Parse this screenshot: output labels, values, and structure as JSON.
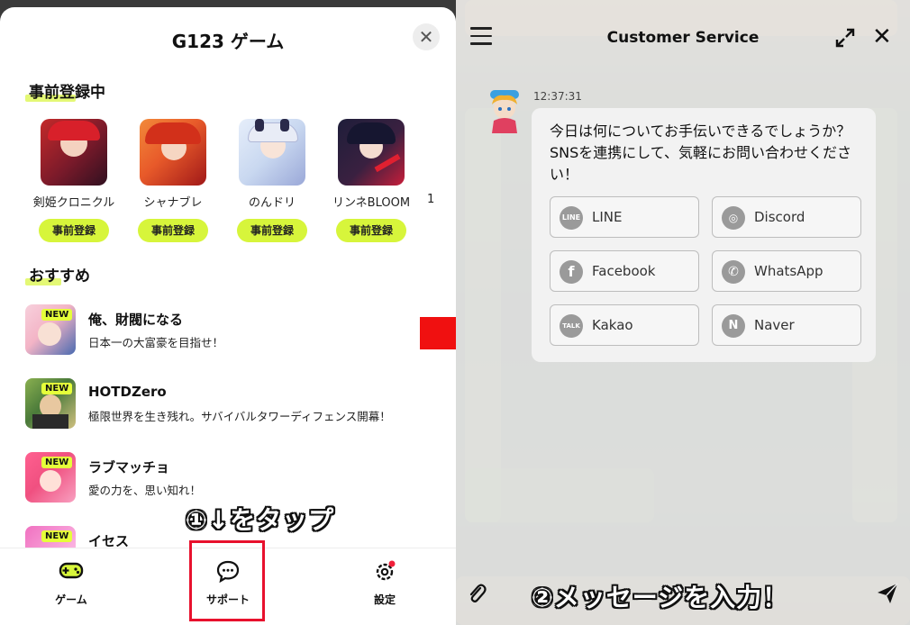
{
  "left": {
    "logo": "G123 ゲーム",
    "close_glyph": "✕",
    "preregister": {
      "title": "事前登録中",
      "items": [
        {
          "name": "剣姫クロニクル",
          "button": "事前登録",
          "color1": "#c42a2a",
          "color2": "#301020"
        },
        {
          "name": "シャナブレ",
          "button": "事前登録",
          "color1": "#e85a2a",
          "color2": "#a01818"
        },
        {
          "name": "のんドリ",
          "button": "事前登録",
          "color1": "#c9d8f0",
          "color2": "#9aa8d8"
        },
        {
          "name": "リンネBLOOM",
          "button": "事前登録",
          "color1": "#1e1e3a",
          "color2": "#c81e3a"
        }
      ],
      "edge_text": "1"
    },
    "recommended": {
      "title": "おすすめ",
      "items": [
        {
          "badge": "NEW",
          "title": "俺、財閥になる",
          "desc": "日本一の大富豪を目指せ！",
          "color1": "#f3b4c6",
          "color2": "#4a6ab0"
        },
        {
          "badge": "NEW",
          "title": "HOTDZero",
          "desc": "極限世界を生き残れ。サバイバルタワーディフェンス開幕！",
          "color1": "#4a7a3a",
          "color2": "#d0c080"
        },
        {
          "badge": "NEW",
          "title": "ラブマッチョ",
          "desc": "愛の力を、思い知れ！",
          "color1": "#f05080",
          "color2": "#f8a0c0"
        },
        {
          "badge": "NEW",
          "title": "イセス",
          "desc": "",
          "color1": "#f070c0",
          "color2": "#ffffff"
        }
      ]
    },
    "instruction": "①↓をタップ",
    "tabs": [
      {
        "label": "ゲーム"
      },
      {
        "label": "サポート"
      },
      {
        "label": "設定"
      }
    ]
  },
  "right": {
    "title": "Customer Service",
    "close_glyph": "✕",
    "timestamp": "12:37:31",
    "message": "今日は何についてお手伝いできるでしょうか？SNSを連携にして、気軽にお問い合わせください！",
    "sns": [
      {
        "label": "LINE",
        "icon": "line-icon",
        "glyph": "LINE"
      },
      {
        "label": "Discord",
        "icon": "discord-icon",
        "glyph": "◎"
      },
      {
        "label": "Facebook",
        "icon": "facebook-icon",
        "glyph": "f"
      },
      {
        "label": "WhatsApp",
        "icon": "whatsapp-icon",
        "glyph": "✆"
      },
      {
        "label": "Kakao",
        "icon": "kakao-icon",
        "glyph": "TALK"
      },
      {
        "label": "Naver",
        "icon": "naver-icon",
        "glyph": "N"
      }
    ],
    "instruction": "②メッセージを入力！"
  },
  "colors": {
    "accent_yellow": "#d7f53b",
    "highlight_red": "#e8112d",
    "arrow_red": "#f01010"
  }
}
